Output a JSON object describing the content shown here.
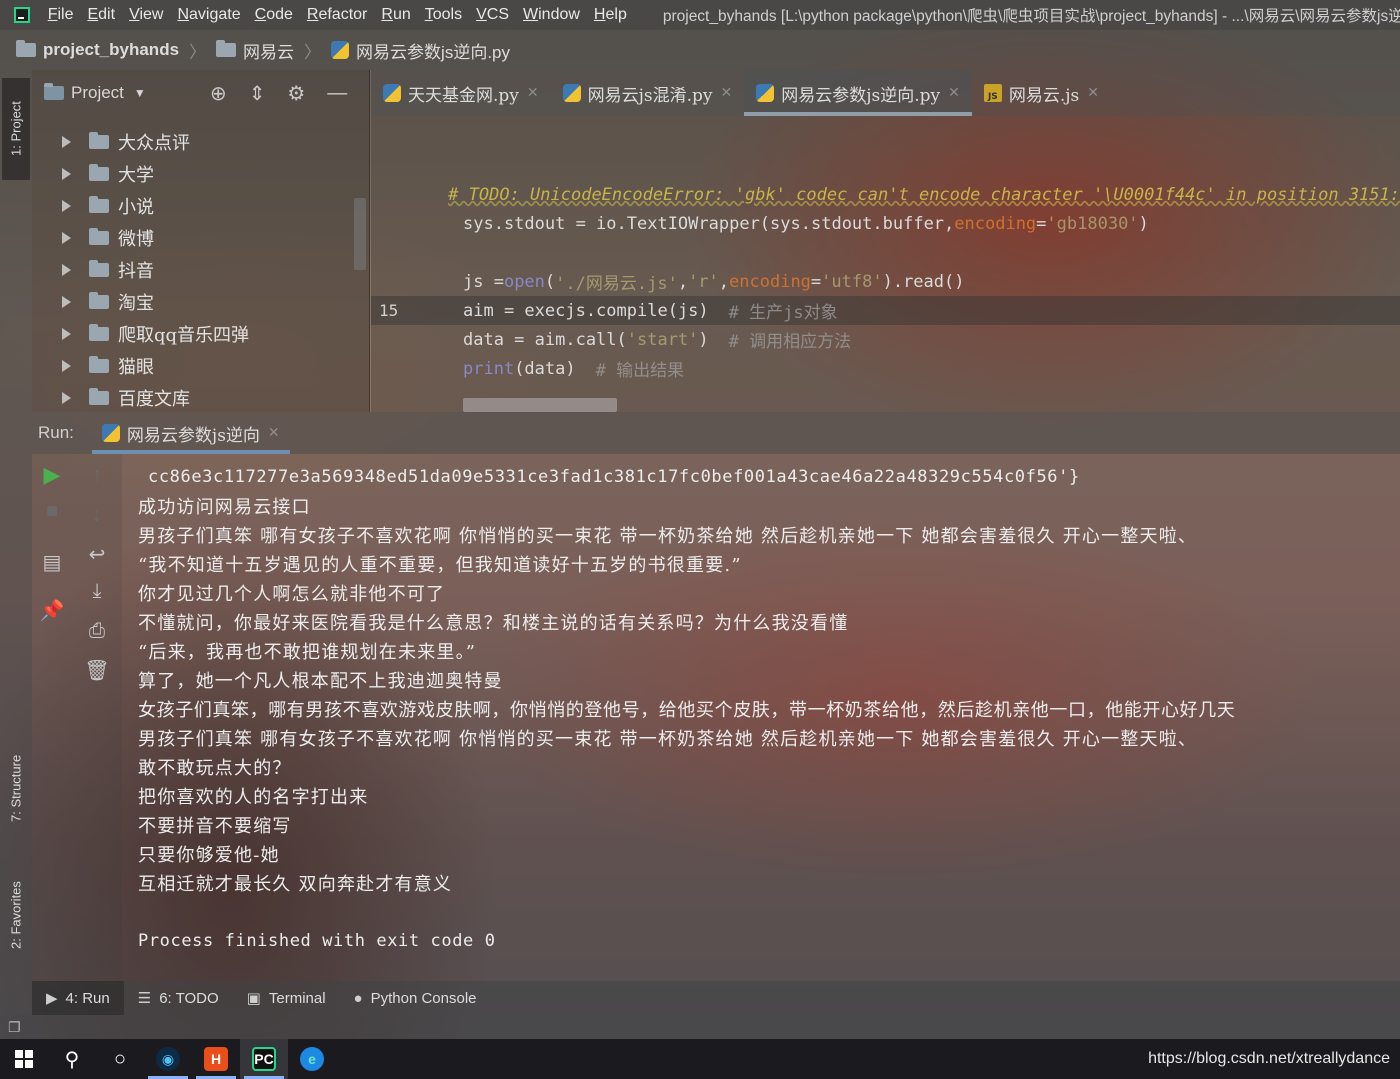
{
  "menubar": {
    "items": [
      "File",
      "Edit",
      "View",
      "Navigate",
      "Code",
      "Refactor",
      "Run",
      "Tools",
      "VCS",
      "Window",
      "Help"
    ],
    "window_title": "project_byhands [L:\\python package\\python\\爬虫\\爬虫项目实战\\project_byhands] - ...\\网易云\\网易云参数js逆向"
  },
  "breadcrumb": {
    "project": "project_byhands",
    "folder": "网易云",
    "file": "网易云参数js逆向.py"
  },
  "left_strip": {
    "project_tab": "1: Project",
    "structure_tab": "7: Structure",
    "favorites_tab": "2: Favorites"
  },
  "project_panel": {
    "title": "Project",
    "tree_items": [
      "大众点评",
      "大学",
      "小说",
      "微博",
      "抖音",
      "淘宝",
      "爬取qq音乐四弹",
      "猫眼",
      "百度文库"
    ]
  },
  "editor_tabs": [
    {
      "label": "天天基金网.py",
      "icon": "python-file-icon",
      "active": false
    },
    {
      "label": "网易云js混淆.py",
      "icon": "python-file-icon",
      "active": false
    },
    {
      "label": "网易云参数js逆向.py",
      "icon": "python-file-icon",
      "active": true
    },
    {
      "label": "网易云.js",
      "icon": "js-file-icon",
      "active": false
    }
  ],
  "editor": {
    "current_line_number": "15",
    "lines": {
      "todo_comment": "# TODO: UnicodeEncodeError: 'gbk' codec can't encode character '\\U0001f44c' in position 3151:",
      "stdout_a": "sys.stdout = io.TextIOWrapper(sys.stdout.buffer,",
      "stdout_param": "encoding",
      "stdout_b": "=",
      "stdout_str": "'gb18030'",
      "stdout_c": ")",
      "open_a": "js = ",
      "open_fn": "open",
      "open_b": "(",
      "open_str1": "'./网易云.js'",
      "open_comma1": ", ",
      "open_str2": "'r'",
      "open_comma2": ", ",
      "open_param": "encoding",
      "open_eq": "=",
      "open_str3": "'utf8'",
      "open_c": ").read()",
      "aim_code": "aim = execjs.compile(js)",
      "aim_comment": "# 生产js对象",
      "data_a": "data = aim.call(",
      "data_str": "'start'",
      "data_b": ")",
      "data_comment": "# 调用相应方法",
      "print_fn": "print",
      "print_b": "(data)",
      "print_comment": "# 输出结果"
    }
  },
  "run_panel": {
    "label": "Run:",
    "tab": "网易云参数js逆向",
    "output": [
      "cc86e3c117277e3a569348ed51da09e5331ce3fad1c381c17fc0bef001a43cae46a22a48329c554c0f56'}",
      "成功访问网易云接口",
      "男孩子们真笨 哪有女孩子不喜欢花啊 你悄悄的买一束花 带一杯奶茶给她 然后趁机亲她一下 她都会害羞很久 开心一整天啦、",
      "“我不知道十五岁遇见的人重不重要，但我知道读好十五岁的书很重要.”",
      "你才见过几个人啊怎么就非他不可了",
      "不懂就问，你最好来医院看我是什么意思？和楼主说的话有关系吗？为什么我没看懂",
      "“后来，我再也不敢把谁规划在未来里。”",
      "算了，她一个凡人根本配不上我迪迦奥特曼",
      "女孩子们真笨，哪有男孩不喜欢游戏皮肤啊，你悄悄的登他号，给他买个皮肤，带一杯奶茶给他，然后趁机亲他一口，他能开心好几天",
      "男孩子们真笨 哪有女孩子不喜欢花啊 你悄悄的买一束花 带一杯奶茶给她 然后趁机亲她一下 她都会害羞很久 开心一整天啦、",
      "敢不敢玩点大的？",
      "把你喜欢的人的名字打出来",
      "不要拼音不要缩写",
      "只要你够爱他-她",
      "互相迁就才最长久 双向奔赴才有意义",
      "",
      "Process finished with exit code 0"
    ]
  },
  "bottom_tabs": {
    "run": "4: Run",
    "todo": "6: TODO",
    "terminal": "Terminal",
    "python_console": "Python Console"
  },
  "taskbar": {
    "url_watermark": "https://blog.csdn.net/xtreallydance"
  },
  "colors": {
    "accent_green": "#21d789",
    "run_green": "#4caf50",
    "tab_underline": "#8f9ea8"
  }
}
